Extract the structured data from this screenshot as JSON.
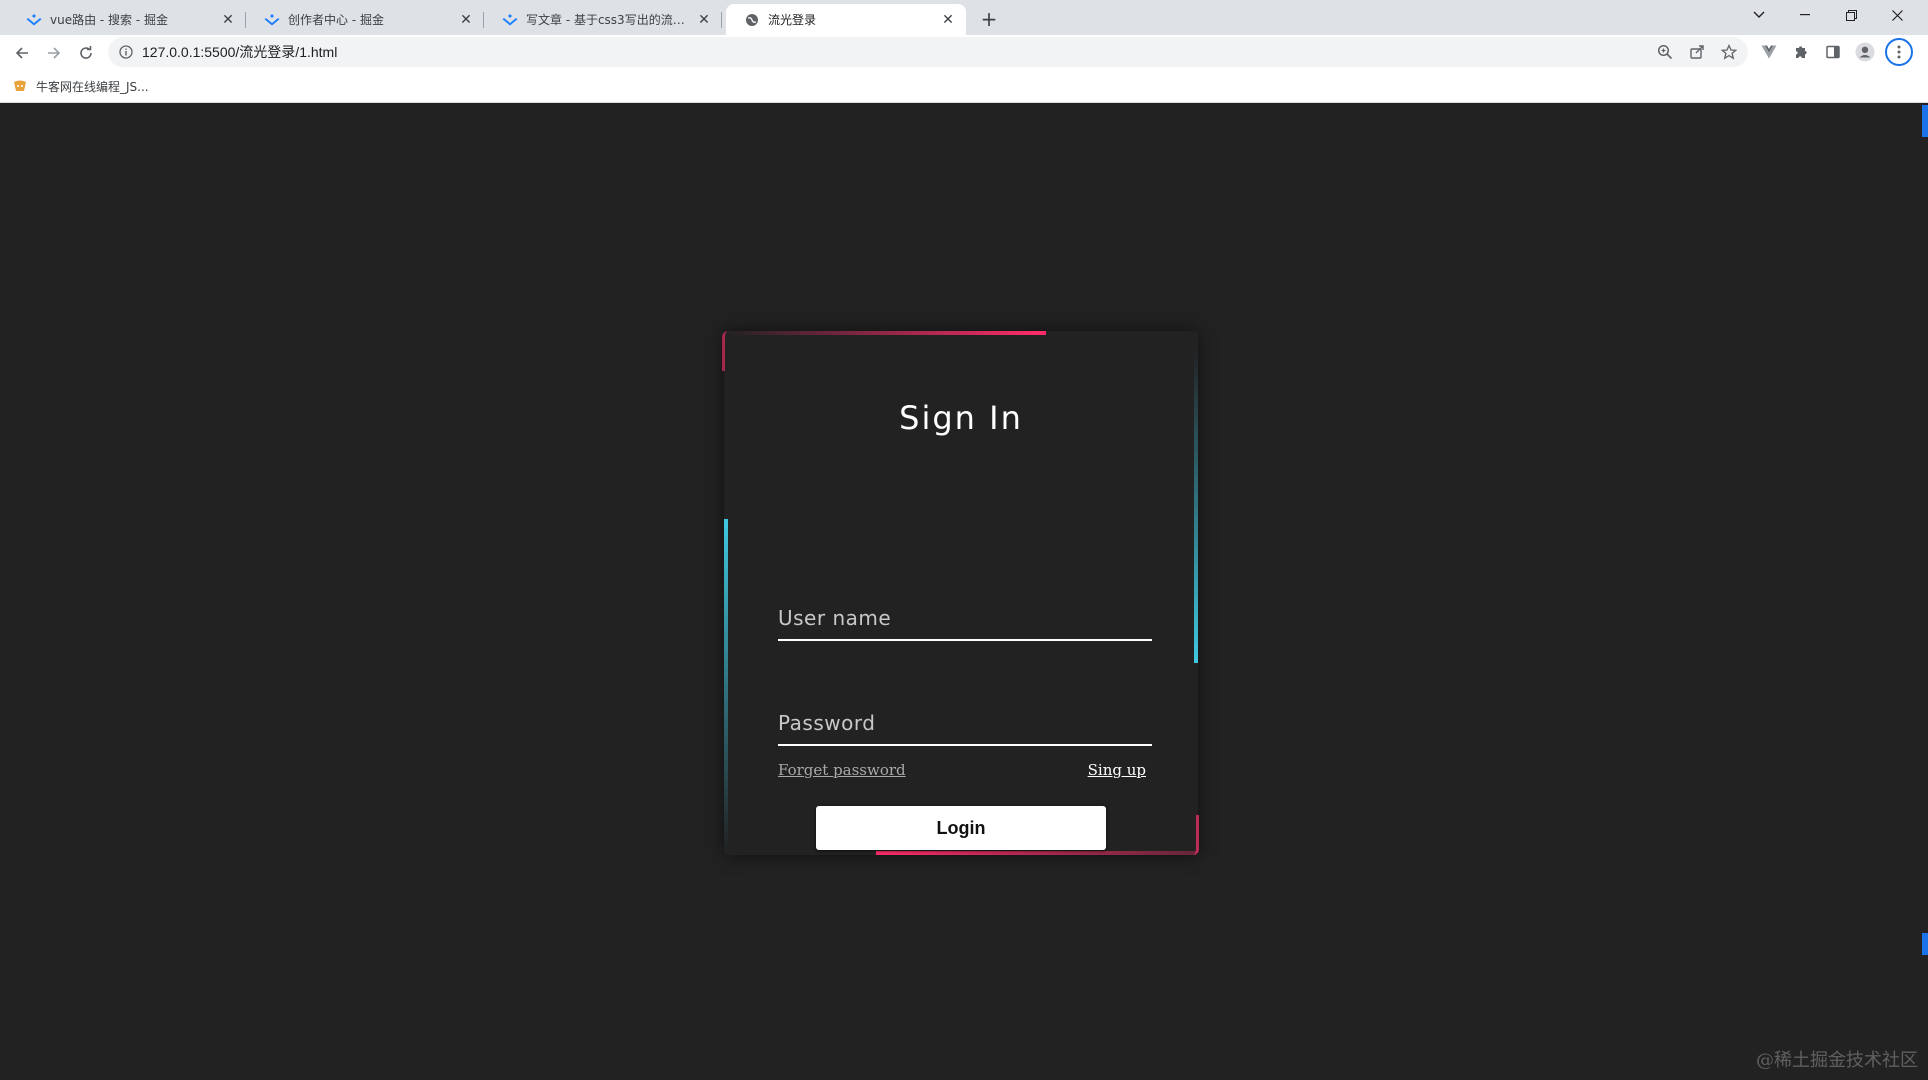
{
  "browser": {
    "tabs": [
      {
        "title": "vue路由 - 搜索 - 掘金",
        "active": false,
        "icon": "juejin-logo-icon"
      },
      {
        "title": "创作者中心 - 掘金",
        "active": false,
        "icon": "juejin-logo-icon"
      },
      {
        "title": "写文章 - 基于css3写出的流光登录",
        "active": false,
        "icon": "juejin-logo-icon"
      },
      {
        "title": "流光登录",
        "active": true,
        "icon": "globe-icon"
      }
    ],
    "url": "127.0.0.1:5500/流光登录/1.html",
    "bookmarks": [
      {
        "label": "牛客网在线编程_JS...",
        "icon": "nowcoder-icon"
      }
    ]
  },
  "login": {
    "title": "Sign In",
    "username_placeholder": "User name",
    "password_placeholder": "Password",
    "forget_label": "Forget password",
    "signup_label": "Sing up",
    "login_label": "Login"
  },
  "colors": {
    "background": "#222223",
    "accent_pink": "#ff2d6a",
    "accent_cyan": "#3fc8e1"
  },
  "watermark": "@稀土掘金技术社区"
}
